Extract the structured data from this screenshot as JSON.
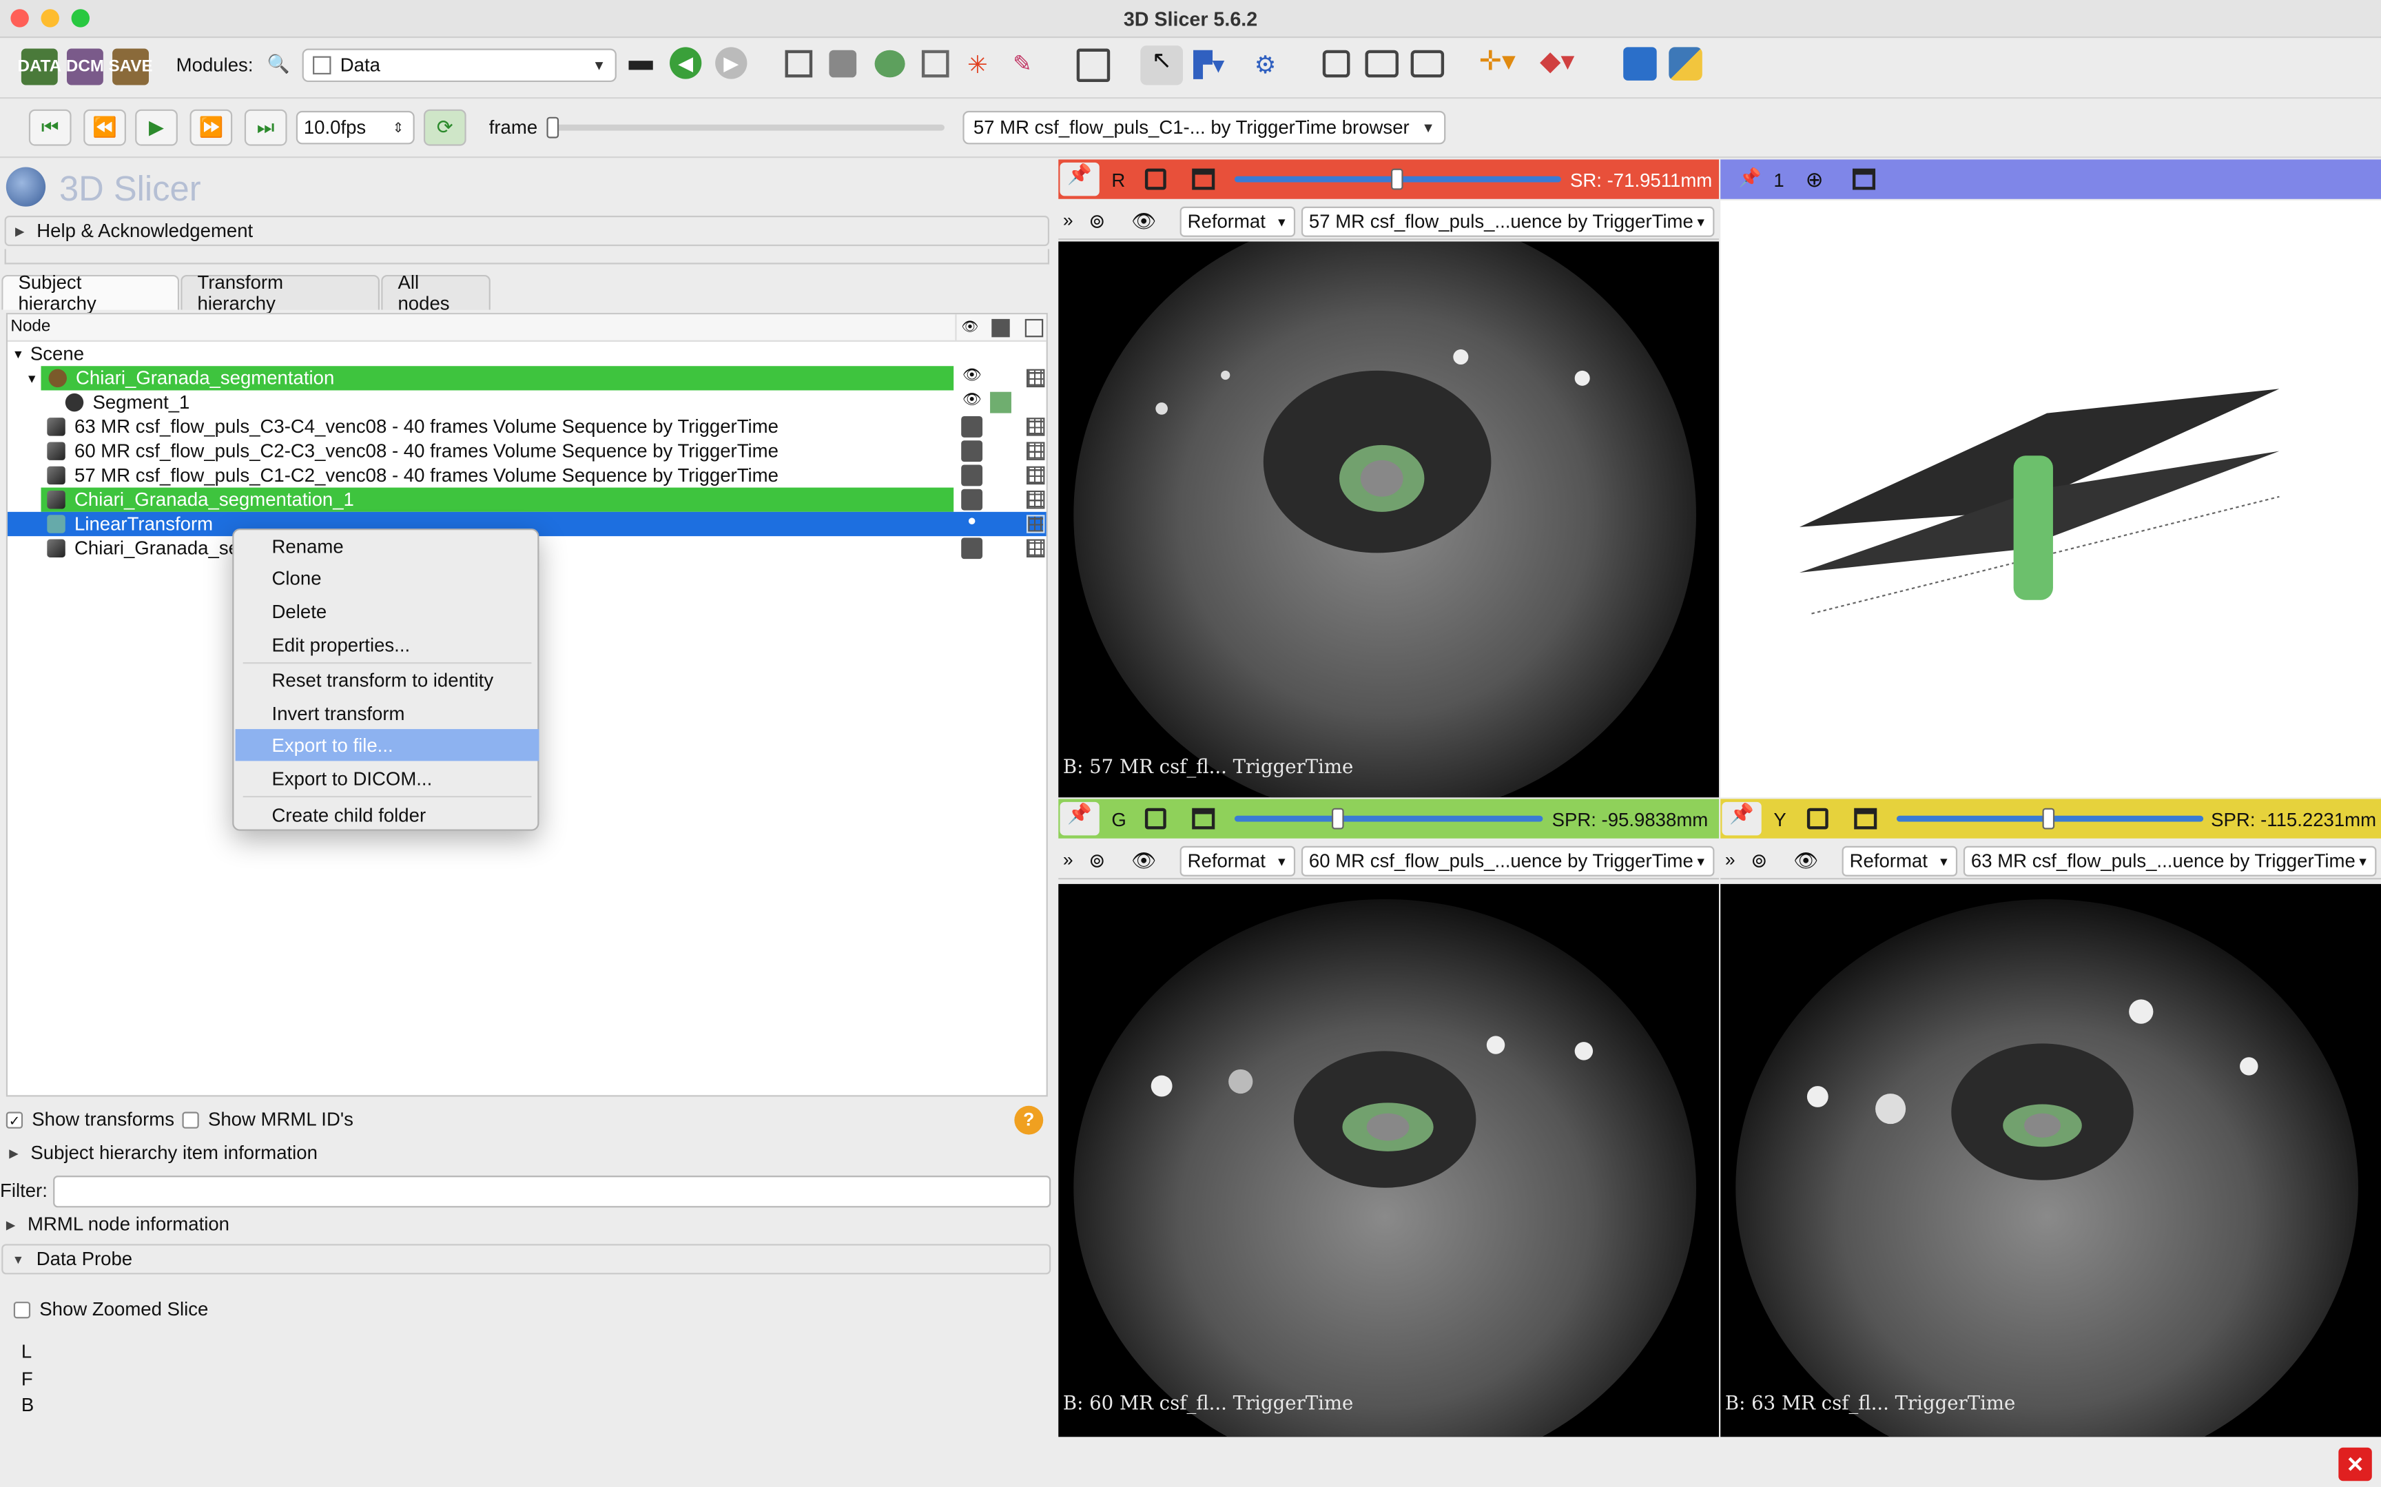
{
  "window": {
    "title": "3D Slicer 5.6.2"
  },
  "toolbar": {
    "data_icon": "DATA",
    "dcm_icon": "DCM",
    "save_icon": "SAVE",
    "modules_label": "Modules:",
    "module_selected": "Data"
  },
  "player": {
    "fps": "10.0fps",
    "frame_label": "frame",
    "browser_selected": "57 MR csf_flow_puls_C1-... by TriggerTime browser"
  },
  "app": {
    "logo_text": "3D Slicer"
  },
  "help_section": "Help & Acknowledgement",
  "tabs": [
    "Subject hierarchy",
    "Transform hierarchy",
    "All nodes"
  ],
  "tree": {
    "column_node": "Node",
    "rows": [
      {
        "label": "Scene"
      },
      {
        "label": "Chiari_Granada_segmentation"
      },
      {
        "label": "Segment_1"
      },
      {
        "label": "63 MR csf_flow_puls_C3-C4_venc08 - 40 frames Volume Sequence by TriggerTime"
      },
      {
        "label": "60 MR csf_flow_puls_C2-C3_venc08 - 40 frames Volume Sequence by TriggerTime"
      },
      {
        "label": "57 MR csf_flow_puls_C1-C2_venc08 - 40 frames Volume Sequence by TriggerTime"
      },
      {
        "label": "Chiari_Granada_segmentation_1"
      },
      {
        "label": "LinearTransform"
      },
      {
        "label": "Chiari_Granada_se"
      }
    ]
  },
  "context_menu": {
    "items": [
      "Rename",
      "Clone",
      "Delete",
      "Edit properties...",
      "Reset transform to identity",
      "Invert transform",
      "Export to file...",
      "Export to DICOM...",
      "Create child folder"
    ]
  },
  "options": {
    "show_transforms": "Show transforms",
    "show_mrml_ids": "Show MRML ID's",
    "item_info": "Subject hierarchy item information",
    "filter_label": "Filter:",
    "filter_value": "",
    "mrml_info": "MRML node information",
    "data_probe": "Data Probe",
    "show_zoomed": "Show Zoomed Slice",
    "probe_l": "L",
    "probe_f": "F",
    "probe_b": "B"
  },
  "views": {
    "red": {
      "letter": "R",
      "offset": "SR: -71.9511mm",
      "reformat": "Reformat",
      "volume": "57 MR csf_flow_puls_...uence by TriggerTime",
      "bg_label": "B: 57 MR csf_fl... TriggerTime"
    },
    "threed": {
      "index": "1"
    },
    "green": {
      "letter": "G",
      "offset": "SPR: -95.9838mm",
      "reformat": "Reformat",
      "volume": "60 MR csf_flow_puls_...uence by TriggerTime",
      "bg_label": "B: 60 MR csf_fl... TriggerTime"
    },
    "yellow": {
      "letter": "Y",
      "offset": "SPR: -115.2231mm",
      "reformat": "Reformat",
      "volume": "63 MR csf_flow_puls_...uence by TriggerTime",
      "bg_label": "B: 63 MR csf_fl... TriggerTime"
    }
  },
  "colors": {
    "red_bar": "#e8503a",
    "green_bar": "#8fd15a",
    "yellow_bar": "#e6d23c",
    "blue_bar": "#7f86e8",
    "selection": "#1d6fe0",
    "segment_green": "#3ec43e"
  }
}
